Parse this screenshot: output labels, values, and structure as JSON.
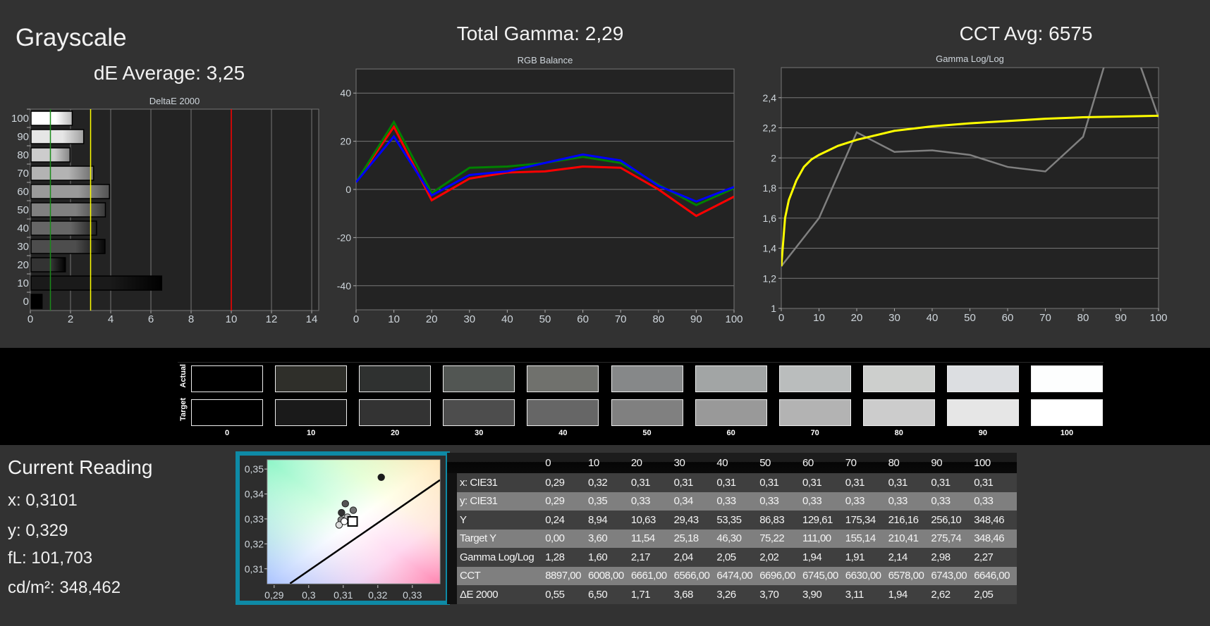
{
  "header": {
    "title": "Grayscale",
    "de_average": "dE Average: 3,25",
    "total_gamma": "Total Gamma: 2,29",
    "cct_avg": "CCT Avg: 6575"
  },
  "chart_data": [
    {
      "type": "bar",
      "title": "DeltaE 2000",
      "orientation": "horizontal",
      "categories": [
        "0",
        "10",
        "20",
        "30",
        "40",
        "50",
        "60",
        "70",
        "80",
        "90",
        "100"
      ],
      "values": [
        0.55,
        6.5,
        1.71,
        3.68,
        3.26,
        3.7,
        3.9,
        3.11,
        1.94,
        2.62,
        2.05
      ],
      "xticks": [
        "0",
        "2",
        "4",
        "6",
        "8",
        "10",
        "12",
        "14"
      ],
      "reference_lines": [
        {
          "value": 1,
          "color": "#1a8a1a"
        },
        {
          "value": 3,
          "color": "#ffff00"
        },
        {
          "value": 10,
          "color": "#ff0000"
        }
      ],
      "grid": true
    },
    {
      "type": "line",
      "title": "RGB Balance",
      "x": [
        0,
        10,
        20,
        30,
        40,
        50,
        60,
        70,
        80,
        90,
        100
      ],
      "ylim": [
        -50,
        50
      ],
      "yticks": [
        "40",
        "20",
        "0",
        "-20",
        "-40"
      ],
      "xticks": [
        "0",
        "10",
        "20",
        "30",
        "40",
        "50",
        "60",
        "70",
        "80",
        "90",
        "100"
      ],
      "grid": true,
      "series": [
        {
          "color": "#ff0000",
          "values": [
            3,
            26,
            -4.5,
            4.5,
            7,
            7.5,
            9.5,
            9,
            0,
            -11,
            -3
          ]
        },
        {
          "color": "#008000",
          "values": [
            3,
            28,
            -1.5,
            9,
            9.5,
            11,
            13.5,
            11,
            2,
            -6.5,
            0.5
          ]
        },
        {
          "color": "#0000ff",
          "values": [
            3,
            22,
            -2.5,
            6,
            7.5,
            11,
            14.5,
            12,
            1.5,
            -5,
            1
          ]
        }
      ]
    },
    {
      "type": "line",
      "title": "Gamma Log/Log",
      "ylim": [
        1,
        2.6
      ],
      "yticks": [
        "1",
        "1,2",
        "1,4",
        "1,6",
        "1,8",
        "2",
        "2,2",
        "2,4"
      ],
      "xticks": [
        "0",
        "10",
        "20",
        "30",
        "40",
        "50",
        "60",
        "70",
        "80",
        "90",
        "100"
      ],
      "grid": true,
      "series": [
        {
          "color": "#808080",
          "x": [
            0,
            10,
            20,
            30,
            40,
            50,
            60,
            70,
            80,
            90,
            100
          ],
          "values": [
            1.28,
            1.6,
            2.17,
            2.04,
            2.05,
            2.02,
            1.94,
            1.91,
            2.14,
            2.98,
            2.27
          ]
        },
        {
          "color": "#ffff00",
          "x": [
            0,
            1,
            2,
            4,
            6,
            8,
            10,
            15,
            20,
            30,
            40,
            50,
            60,
            70,
            80,
            90,
            100
          ],
          "values": [
            1.28,
            1.6,
            1.72,
            1.85,
            1.94,
            1.99,
            2.02,
            2.08,
            2.12,
            2.18,
            2.21,
            2.23,
            2.245,
            2.26,
            2.27,
            2.275,
            2.28
          ]
        }
      ]
    },
    {
      "type": "scatter",
      "title": "",
      "xlim": [
        0.288,
        0.338
      ],
      "ylim": [
        0.304,
        0.3537
      ],
      "xticks": [
        "0,29",
        "0,3",
        "0,31",
        "0,32",
        "0,33"
      ],
      "yticks": [
        "0,35",
        "0,34",
        "0,33",
        "0,32",
        "0,31"
      ],
      "points": [
        {
          "x": 0.321,
          "y": 0.3467,
          "fill": "#1a1a1a"
        },
        {
          "x": 0.3106,
          "y": 0.3361,
          "fill": "#555"
        },
        {
          "x": 0.3095,
          "y": 0.3325,
          "fill": "#333"
        },
        {
          "x": 0.3129,
          "y": 0.3335,
          "fill": "#707070"
        },
        {
          "x": 0.3094,
          "y": 0.3296,
          "fill": "#888"
        },
        {
          "x": 0.3112,
          "y": 0.3307,
          "fill": "#bbb"
        },
        {
          "x": 0.3088,
          "y": 0.3276,
          "fill": "#ddd"
        },
        {
          "x": 0.3103,
          "y": 0.329,
          "fill": "#fff"
        }
      ],
      "target": {
        "x": 0.3127,
        "y": 0.329
      },
      "planckian": [
        [
          0.2946,
          0.3041
        ],
        [
          0.338,
          0.3456
        ]
      ]
    }
  ],
  "swatches": {
    "actual_label": "Actual",
    "target_label": "Target",
    "labels": [
      "0",
      "10",
      "20",
      "30",
      "40",
      "50",
      "60",
      "70",
      "80",
      "90",
      "100"
    ],
    "actual": [
      "#000000",
      "#2f2f2a",
      "#2f3130",
      "#525653",
      "#70716d",
      "#868889",
      "#a2a5a5",
      "#babdbd",
      "#cdcfcd",
      "#dcdee1",
      "#fdfefe"
    ],
    "target": [
      "#000000",
      "#1a1a1a",
      "#333333",
      "#4d4d4d",
      "#666666",
      "#808080",
      "#999999",
      "#b3b3b3",
      "#cccccc",
      "#e6e6e6",
      "#ffffff"
    ]
  },
  "reading": {
    "title": "Current Reading",
    "x": "x: 0,3101",
    "y": "y: 0,329",
    "fl": "fL: 101,703",
    "cdm2": "cd/m²: 348,462"
  },
  "table": {
    "columns": [
      "0",
      "10",
      "20",
      "30",
      "40",
      "50",
      "60",
      "70",
      "80",
      "90",
      "100"
    ],
    "rows": [
      {
        "label": "x: CIE31",
        "values": [
          "0,29",
          "0,32",
          "0,31",
          "0,31",
          "0,31",
          "0,31",
          "0,31",
          "0,31",
          "0,31",
          "0,31",
          "0,31"
        ]
      },
      {
        "label": "y: CIE31",
        "values": [
          "0,29",
          "0,35",
          "0,33",
          "0,34",
          "0,33",
          "0,33",
          "0,33",
          "0,33",
          "0,33",
          "0,33",
          "0,33"
        ]
      },
      {
        "label": "Y",
        "values": [
          "0,24",
          "8,94",
          "10,63",
          "29,43",
          "53,35",
          "86,83",
          "129,61",
          "175,34",
          "216,16",
          "256,10",
          "348,46"
        ]
      },
      {
        "label": "Target Y",
        "values": [
          "0,00",
          "3,60",
          "11,54",
          "25,18",
          "46,30",
          "75,22",
          "111,00",
          "155,14",
          "210,41",
          "275,74",
          "348,46"
        ]
      },
      {
        "label": "Gamma Log/Log",
        "values": [
          "1,28",
          "1,60",
          "2,17",
          "2,04",
          "2,05",
          "2,02",
          "1,94",
          "1,91",
          "2,14",
          "2,98",
          "2,27"
        ]
      },
      {
        "label": "CCT",
        "values": [
          "8897,00",
          "6008,00",
          "6661,00",
          "6566,00",
          "6474,00",
          "6696,00",
          "6745,00",
          "6630,00",
          "6578,00",
          "6743,00",
          "6646,00"
        ]
      },
      {
        "label": "ΔE 2000",
        "values": [
          "0,55",
          "6,50",
          "1,71",
          "3,68",
          "3,26",
          "3,70",
          "3,90",
          "3,11",
          "1,94",
          "2,62",
          "2,05"
        ]
      }
    ]
  }
}
